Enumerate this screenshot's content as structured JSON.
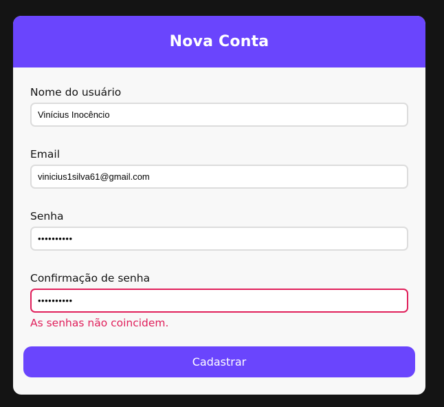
{
  "header": {
    "title": "Nova Conta"
  },
  "form": {
    "username": {
      "label": "Nome do usuário",
      "value": "Vinícius Inocêncio"
    },
    "email": {
      "label": "Email",
      "value": "vinicius1silva61@gmail.com"
    },
    "password": {
      "label": "Senha",
      "value": "••••••••••"
    },
    "confirm_password": {
      "label": "Confirmação de senha",
      "value": "••••••••••",
      "error": "As senhas não coincidem."
    },
    "submit_label": "Cadastrar"
  },
  "colors": {
    "accent": "#6a45fd",
    "error": "#e01e5a",
    "background": "#141414",
    "card": "#f8f8f8"
  }
}
